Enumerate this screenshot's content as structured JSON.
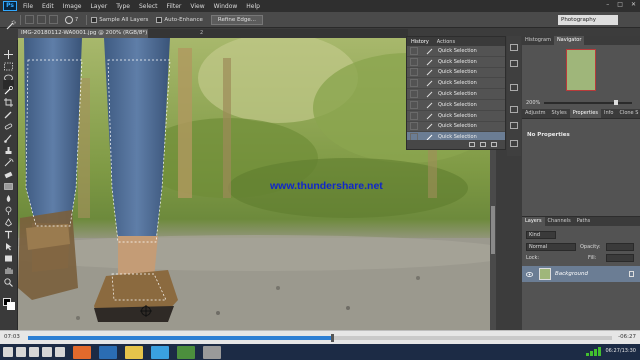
{
  "app": {
    "logo": "Ps",
    "menu": [
      "File",
      "Edit",
      "Image",
      "Layer",
      "Type",
      "Select",
      "Filter",
      "View",
      "Window",
      "Help"
    ],
    "window_controls": [
      "–",
      "□",
      "✕"
    ]
  },
  "options_bar": {
    "brush_size": "7",
    "sample_all_layers": "Sample All Layers",
    "auto_enhance": "Auto-Enhance",
    "refine_edge": "Refine Edge...",
    "workspace": "Photography"
  },
  "document": {
    "tab_title": "IMG-20180112-WA0001.jpg @ 200% (RGB/8*)",
    "ruler_mark": "2",
    "watermark": "www.thundershare.net"
  },
  "history_panel": {
    "tabs": [
      "History",
      "Actions"
    ],
    "items": [
      "Quick Selection",
      "Quick Selection",
      "Quick Selection",
      "Quick Selection",
      "Quick Selection",
      "Quick Selection",
      "Quick Selection",
      "Quick Selection",
      "Quick Selection"
    ],
    "selected_index": 8
  },
  "right_panels": {
    "top_tabs": [
      "Histogram",
      "Navigator"
    ],
    "zoom": "200%",
    "mid_tabs": [
      "Adjustm",
      "Styles",
      "Properties",
      "Info",
      "Clone S"
    ],
    "properties_text": "No Properties",
    "layer_tabs": [
      "Layers",
      "Channels",
      "Paths"
    ],
    "kind": "Kind",
    "blend_mode": "Normal",
    "opacity_label": "Opacity:",
    "lock_label": "Lock:",
    "fill_label": "Fill:",
    "layer_name": "Background"
  },
  "player": {
    "time_elapsed": "07:03",
    "time_remaining": "-06:27",
    "progress": 0.52
  },
  "taskbar": {
    "tray_text": "06:27/13:30",
    "colors": {
      "taskbar": "#1c2b45",
      "accent": "#31a8ff",
      "selection": "#6b7d94"
    }
  }
}
